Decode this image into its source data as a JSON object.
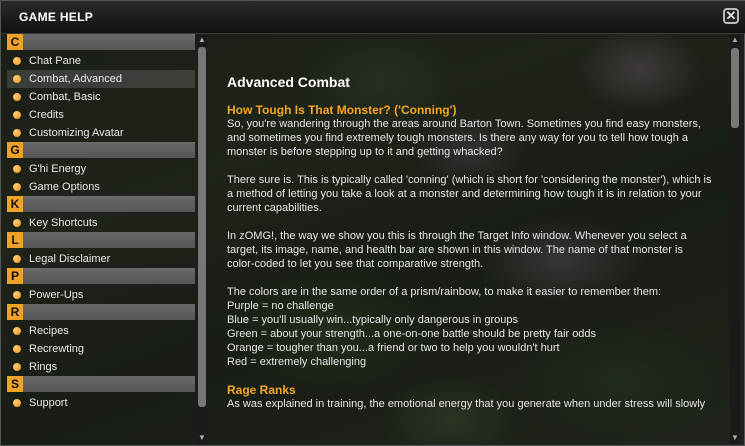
{
  "window": {
    "title": "GAME HELP",
    "close_label": "✕"
  },
  "sidebar": {
    "sections": [
      {
        "letter": "C",
        "items": [
          "Chat Pane",
          "Combat, Advanced",
          "Combat, Basic",
          "Credits",
          "Customizing Avatar"
        ]
      },
      {
        "letter": "G",
        "items": [
          "G'hi Energy",
          "Game Options"
        ]
      },
      {
        "letter": "K",
        "items": [
          "Key Shortcuts"
        ]
      },
      {
        "letter": "L",
        "items": [
          "Legal Disclaimer"
        ]
      },
      {
        "letter": "P",
        "items": [
          "Power-Ups"
        ]
      },
      {
        "letter": "R",
        "items": [
          "Recipes",
          "Recrewting",
          "Rings"
        ]
      },
      {
        "letter": "S",
        "items": [
          "Support"
        ]
      }
    ],
    "selected": "Combat, Advanced"
  },
  "article": {
    "title": "Advanced Combat",
    "section1_heading": "How Tough Is That Monster? ('Conning')",
    "p1": [
      "So, you're wandering through the areas around Barton Town. Sometimes you find easy monsters,",
      "and sometimes you find extremely tough monsters. Is there any way for you to tell how tough a",
      "monster is before stepping up to it and getting whacked?"
    ],
    "p2": [
      "There sure is. This is typically called 'conning' (which is short for 'considering the monster'), which is",
      "a method of letting you take a look at a monster and determining how tough it is in relation to your",
      "current capabilities."
    ],
    "p3": [
      "In zOMG!, the way we show you this is through the Target Info window. Whenever you select a",
      "target, its image, name, and health bar are shown in this window. The name of that monster is",
      "color-coded to let you see that comparative strength."
    ],
    "p4": [
      "The colors are in the same order of a prism/rainbow, to make it easier to remember them:",
      "Purple = no challenge",
      "Blue = you'll usually win...typically only dangerous in groups",
      "Green = about your strength...a one-on-one battle should be pretty fair odds",
      "Orange = tougher than you...a friend or two to help you wouldn't hurt",
      "Red = extremely challenging"
    ],
    "section2_heading": "Rage Ranks",
    "p5": [
      "As was explained in training, the emotional energy that you generate when under stress will slowly"
    ]
  }
}
